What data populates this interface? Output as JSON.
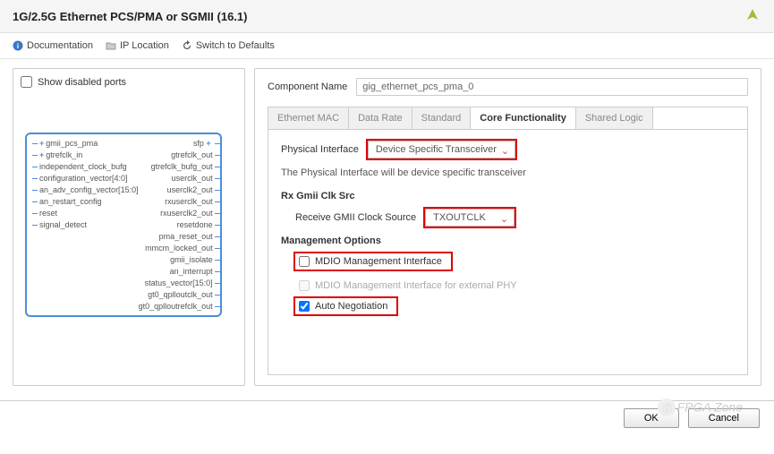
{
  "title": "1G/2.5G Ethernet PCS/PMA or SGMII (16.1)",
  "topLinks": {
    "documentation": "Documentation",
    "ipLocation": "IP Location",
    "switchDefaults": "Switch to Defaults"
  },
  "leftPanel": {
    "showDisabled": "Show disabled ports",
    "leftPorts": [
      "gmii_pcs_pma",
      "gtrefclk_in",
      "independent_clock_bufg",
      "configuration_vector[4:0]",
      "an_adv_config_vector[15:0]",
      "an_restart_config",
      "reset",
      "signal_detect"
    ],
    "rightPorts": [
      "sfp",
      "gtrefclk_out",
      "gtrefclk_bufg_out",
      "userclk_out",
      "userclk2_out",
      "rxuserclk_out",
      "rxuserclk2_out",
      "resetdone",
      "pma_reset_out",
      "mmcm_locked_out",
      "gmii_isolate",
      "an_interrupt",
      "status_vector[15:0]",
      "gt0_qplloutclk_out",
      "gt0_qplloutrefclk_out"
    ]
  },
  "componentName": {
    "label": "Component Name",
    "value": "gig_ethernet_pcs_pma_0"
  },
  "tabs": [
    "Ethernet MAC",
    "Data Rate",
    "Standard",
    "Core Functionality",
    "Shared Logic"
  ],
  "activeTab": 3,
  "physicalInterface": {
    "label": "Physical Interface",
    "value": "Device Specific Transceiver",
    "info": "The Physical Interface will be device specific transceiver"
  },
  "rxSection": {
    "title": "Rx Gmii Clk Src",
    "label": "Receive GMII Clock Source",
    "value": "TXOUTCLK"
  },
  "mgmt": {
    "title": "Management Options",
    "mdio": "MDIO Management Interface",
    "mdioExt": "MDIO Management Interface for external PHY",
    "autoNeg": "Auto Negotiation"
  },
  "buttons": {
    "ok": "OK",
    "cancel": "Cancel"
  },
  "watermark": "FPGA Zone"
}
